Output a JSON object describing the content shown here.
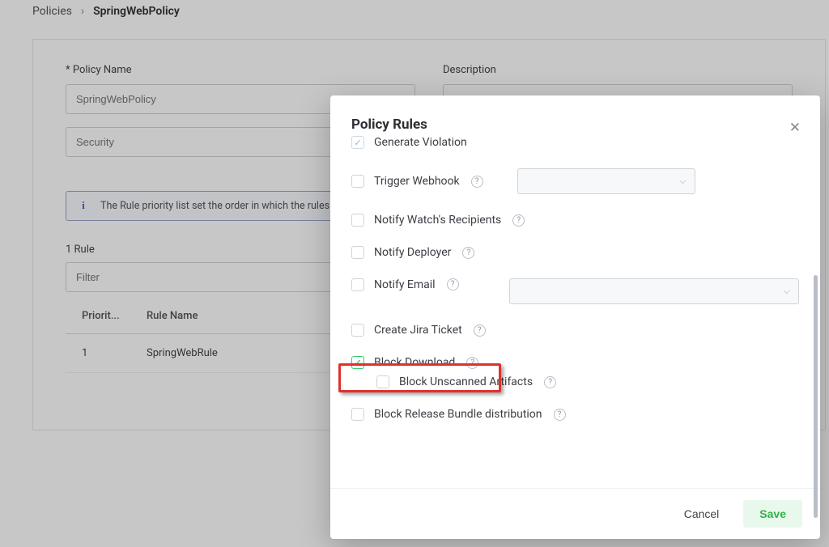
{
  "breadcrumb": {
    "root": "Policies",
    "current": "SpringWebPolicy"
  },
  "form": {
    "name_label": "* Policy Name",
    "name_value": "SpringWebPolicy",
    "desc_label": "Description",
    "type_value": "Security",
    "info_text": "The Rule priority list set the order in which the rules are applied.",
    "rules_count_label": "1 Rule",
    "filter_placeholder": "Filter",
    "th_priority": "Priorit...",
    "th_name": "Rule Name",
    "row": {
      "priority": "1",
      "name": "SpringWebRule"
    }
  },
  "modal": {
    "title": "Policy Rules",
    "rules": {
      "generate_violation": "Generate Violation",
      "trigger_webhook": "Trigger Webhook",
      "notify_watch": "Notify Watch's Recipients",
      "notify_deployer": "Notify Deployer",
      "notify_email": "Notify Email",
      "create_jira": "Create Jira Ticket",
      "block_download": "Block Download",
      "block_unscanned": "Block Unscanned Artifacts",
      "block_release": "Block Release Bundle distribution"
    },
    "cancel": "Cancel",
    "save": "Save"
  }
}
